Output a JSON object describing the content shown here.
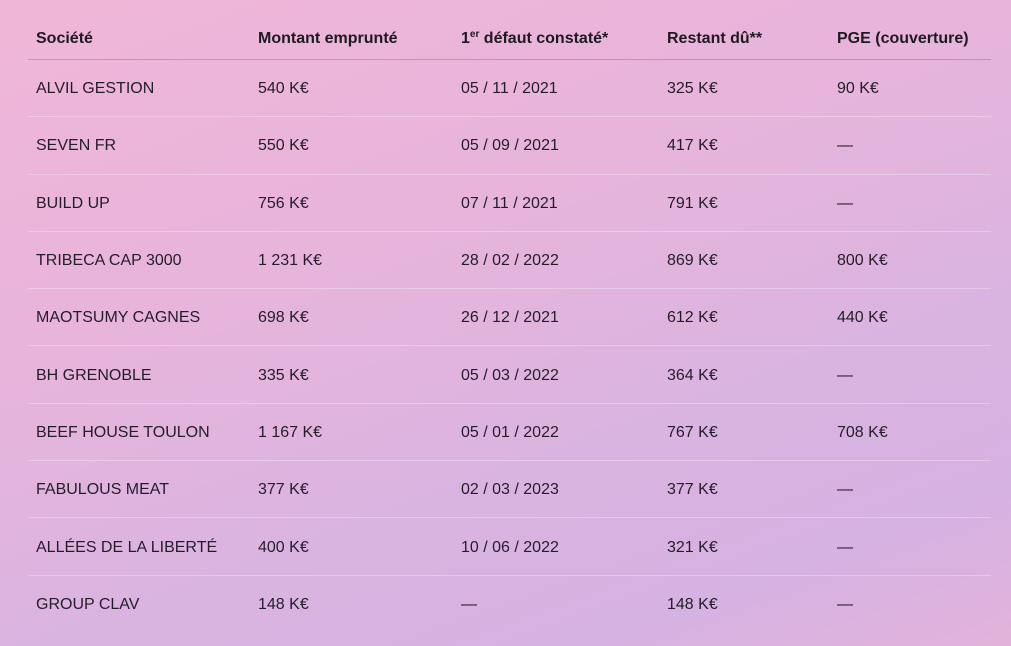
{
  "table": {
    "headers": [
      {
        "text": "Société",
        "sup": ""
      },
      {
        "text": "Montant emprunté",
        "sup": ""
      },
      {
        "text": " défaut constaté*",
        "prefix": "1",
        "sup": "er"
      },
      {
        "text": "Restant dû**",
        "sup": ""
      },
      {
        "text": "PGE (couverture)",
        "sup": ""
      }
    ],
    "rows": [
      [
        "ALVIL GESTION",
        "540 K€",
        "05 / 11 / 2021",
        "325 K€",
        "90 K€"
      ],
      [
        "SEVEN FR",
        "550 K€",
        "05 / 09 / 2021",
        "417 K€",
        "—"
      ],
      [
        "BUILD UP",
        "756 K€",
        "07 / 11 / 2021",
        "791 K€",
        "—"
      ],
      [
        "TRIBECA CAP 3000",
        "1 231 K€",
        "28 / 02 / 2022",
        "869 K€",
        "800 K€"
      ],
      [
        "MAOTSUMY CAGNES",
        "698 K€",
        "26 / 12 / 2021",
        "612 K€",
        "440 K€"
      ],
      [
        "BH GRENOBLE",
        "335 K€",
        "05 / 03 / 2022",
        "364 K€",
        "—"
      ],
      [
        "BEEF HOUSE TOULON",
        "1 167 K€",
        "05 / 01 / 2022",
        "767 K€",
        "708 K€"
      ],
      [
        "FABULOUS MEAT",
        "377 K€",
        "02 / 03 / 2023",
        "377 K€",
        "—"
      ],
      [
        "ALLÉES DE LA LIBERTÉ",
        "400 K€",
        "10 / 06 / 2022",
        "321 K€",
        "—"
      ],
      [
        "GROUP CLAV",
        "148 K€",
        "—",
        "148 K€",
        "—"
      ]
    ]
  }
}
